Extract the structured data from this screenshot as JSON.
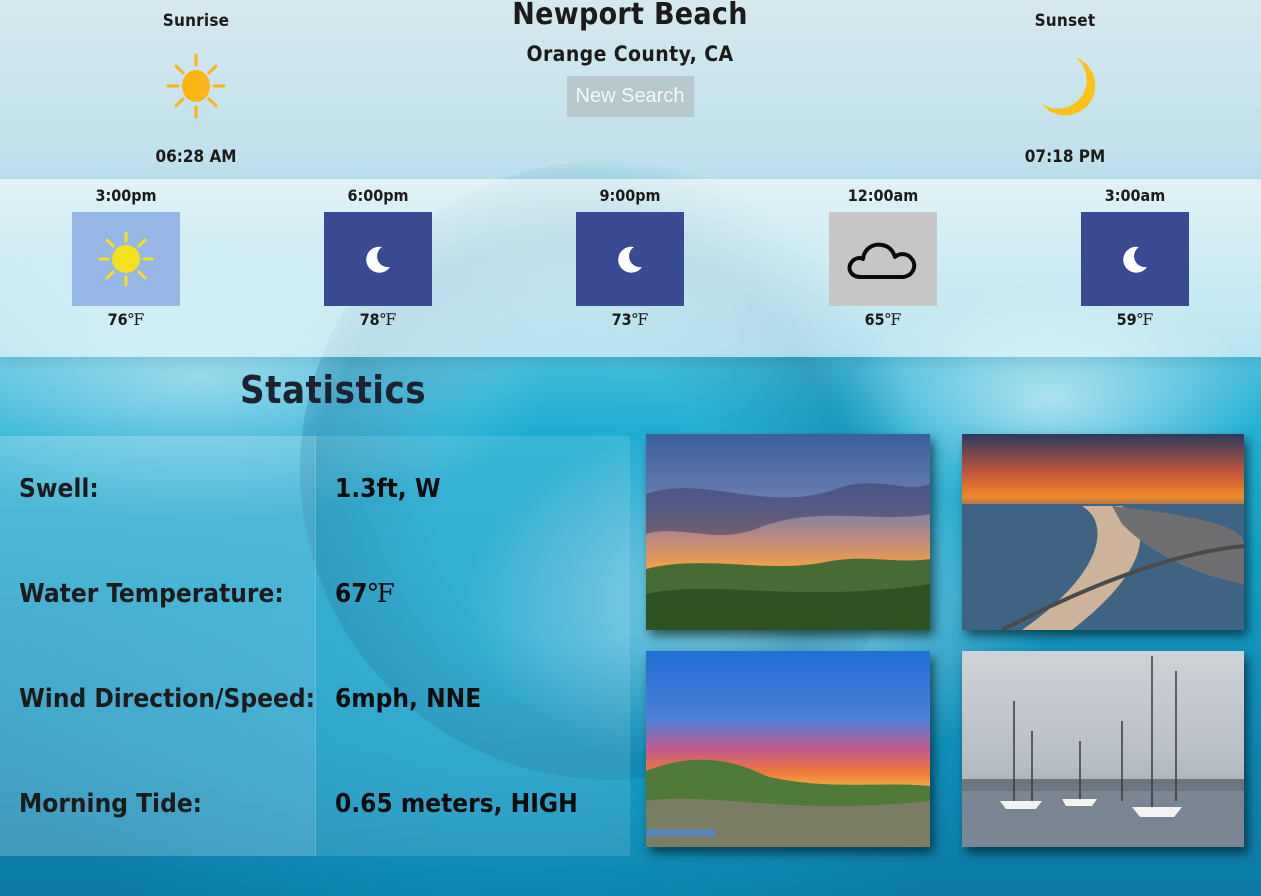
{
  "header": {
    "city": "Newport Beach",
    "county": "Orange County, CA",
    "new_search_label": "New Search",
    "sunrise": {
      "label": "Sunrise",
      "time": "06:28 AM",
      "icon": "sun-icon"
    },
    "sunset": {
      "label": "Sunset",
      "time": "07:18 PM",
      "icon": "moon-icon"
    }
  },
  "forecast": [
    {
      "time": "3:00pm",
      "temp": "76",
      "unit": "℉",
      "icon": "sun-icon"
    },
    {
      "time": "6:00pm",
      "temp": "78",
      "unit": "℉",
      "icon": "moon-icon"
    },
    {
      "time": "9:00pm",
      "temp": "73",
      "unit": "℉",
      "icon": "moon-icon"
    },
    {
      "time": "12:00am",
      "temp": "65",
      "unit": "℉",
      "icon": "cloud-icon"
    },
    {
      "time": "3:00am",
      "temp": "59",
      "unit": "℉",
      "icon": "moon-icon"
    }
  ],
  "statistics": {
    "title": "Statistics",
    "rows": [
      {
        "label": "Swell:",
        "value": "1.3ft, W",
        "unit": ""
      },
      {
        "label": "Water Temperature:",
        "value": "67",
        "unit": "℉"
      },
      {
        "label": "Wind Direction/Speed:",
        "value": "6mph, NNE",
        "unit": ""
      },
      {
        "label": "Morning Tide:",
        "value": "0.65 meters, HIGH",
        "unit": ""
      }
    ]
  },
  "colors": {
    "sunny_tile": "#96b7e6",
    "night_tile": "#3a4a92",
    "cloud_tile": "#c6c6c6",
    "sun": "#fbb515",
    "moon": "#fbc31a"
  }
}
